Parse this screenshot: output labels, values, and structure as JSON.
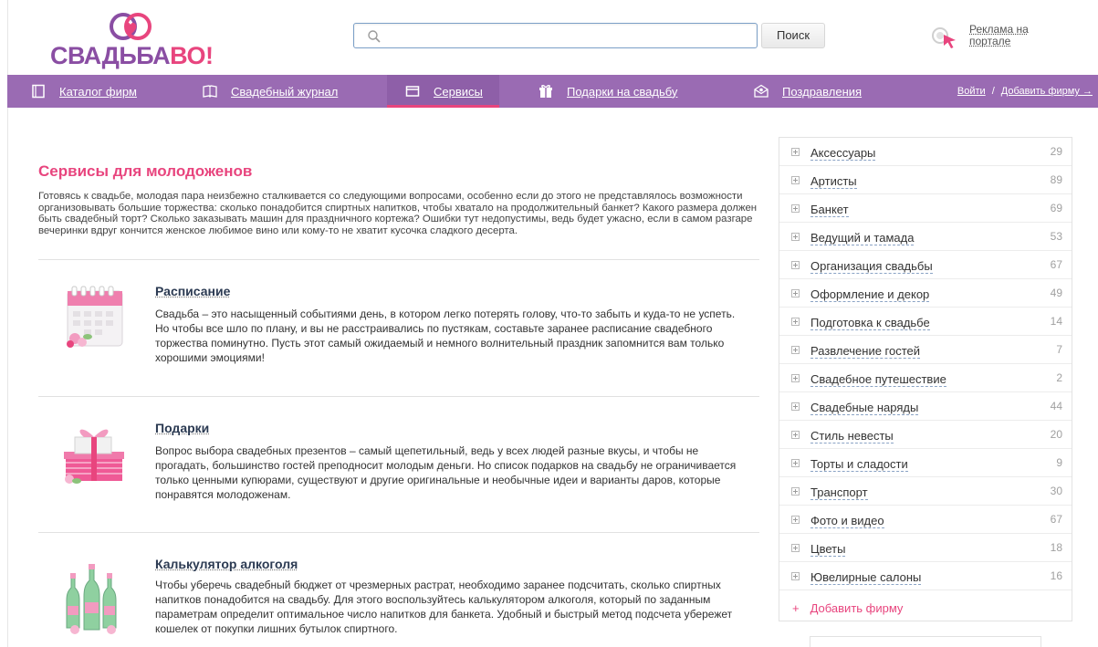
{
  "header": {
    "logo_part1": "СВАДЬБА",
    "logo_part2": "ВО!",
    "search_placeholder": "",
    "search_button": "Поиск",
    "ad_text": "Реклама на портале"
  },
  "nav": {
    "items": [
      {
        "label": "Каталог фирм",
        "icon": "catalog-icon"
      },
      {
        "label": "Свадебный журнал",
        "icon": "book-icon"
      },
      {
        "label": "Сервисы",
        "icon": "services-icon",
        "active": true
      },
      {
        "label": "Подарки на свадьбу",
        "icon": "gift-icon"
      },
      {
        "label": "Поздравления",
        "icon": "envelope-icon"
      }
    ],
    "login": "Войти",
    "separator": "/",
    "add_firm": "Добавить фирму →"
  },
  "main": {
    "title": "Сервисы для молодоженов",
    "intro": "Готовясь к свадьбе, молодая пара неизбежно сталкивается со следующими вопросами, особенно если до этого не представлялось возможности организовывать большие торжества: сколько понадобится спиртных напитков, чтобы хватало на продолжительный банкет? Какого размера должен быть свадебный торт? Сколько заказывать машин для праздничного кортежа? Ошибки тут недопустимы, ведь будет ужасно, если в самом разгаре вечеринки вдруг кончится женское любимое вино или кому-то не хватит кусочка сладкого десерта.",
    "services": [
      {
        "title": "Расписание",
        "text": "Свадьба – это насыщенный событиями день, в котором легко потерять голову, что-то забыть и куда-то не успеть. Но чтобы все шло по плану, и вы не расстраивались по пустякам, составьте заранее расписание свадебного торжества поминутно. Пусть этот самый ожидаемый и немного волнительный праздник запомнится вам только хорошими эмоциями!",
        "icon": "calendar-icon"
      },
      {
        "title": "Подарки",
        "text": "Вопрос выбора свадебных презентов – самый щепетильный, ведь у всех людей разные вкусы, и чтобы не прогадать, большинство гостей преподносит молодым деньги. Но список подарков на свадьбу не ограничивается только ценными купюрами, существуют и другие оригинальные и необычные идеи и варианты даров, которые понравятся молодоженам.",
        "icon": "gift-box-icon"
      },
      {
        "title": "Калькулятор алкоголя",
        "text": "Чтобы уберечь свадебный бюджет от чрезмерных растрат, необходимо заранее подсчитать, сколько спиртных напитков понадобится на свадьбу. Для этого воспользуйтесь калькулятором алкоголя, который по заданным параметрам определит оптимальное число напитков для банкета. Удобный и быстрый метод подсчета убережет кошелек от покупки лишних бутылок спиртного.",
        "icon": "bottles-icon"
      }
    ]
  },
  "sidebar": {
    "categories": [
      {
        "name": "Аксессуары",
        "count": "29"
      },
      {
        "name": "Артисты",
        "count": "89"
      },
      {
        "name": "Банкет",
        "count": "69"
      },
      {
        "name": "Ведущий и тамада",
        "count": "53"
      },
      {
        "name": "Организация свадьбы",
        "count": "67"
      },
      {
        "name": "Оформление и декор",
        "count": "49"
      },
      {
        "name": "Подготовка к свадьбе",
        "count": "14"
      },
      {
        "name": "Развлечение гостей",
        "count": "7"
      },
      {
        "name": "Свадебное путешествие",
        "count": "2"
      },
      {
        "name": "Свадебные наряды",
        "count": "44"
      },
      {
        "name": "Стиль невесты",
        "count": "20"
      },
      {
        "name": "Торты и сладости",
        "count": "9"
      },
      {
        "name": "Транспорт",
        "count": "30"
      },
      {
        "name": "Фото и видео",
        "count": "67"
      },
      {
        "name": "Цветы",
        "count": "18"
      },
      {
        "name": "Ювелирные салоны",
        "count": "16"
      }
    ],
    "add_firm_plus": "+",
    "add_firm": "Добавить фирму"
  },
  "colors": {
    "nav_bg": "#9a6bb3",
    "accent_pink": "#e8457e",
    "logo_purple": "#8a4ea3",
    "title_navy": "#2b3a52"
  }
}
